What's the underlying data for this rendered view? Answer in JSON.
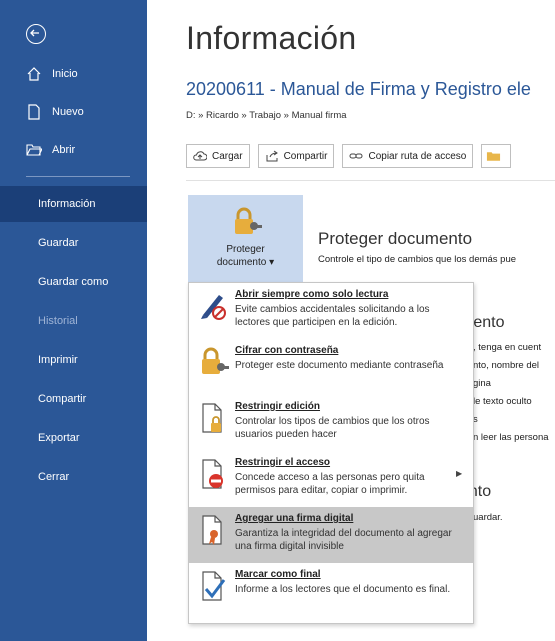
{
  "sidebar": {
    "items": [
      {
        "label": "Inicio"
      },
      {
        "label": "Nuevo"
      },
      {
        "label": "Abrir"
      },
      {
        "label": "Información"
      },
      {
        "label": "Guardar"
      },
      {
        "label": "Guardar como"
      },
      {
        "label": "Historial"
      },
      {
        "label": "Imprimir"
      },
      {
        "label": "Compartir"
      },
      {
        "label": "Exportar"
      },
      {
        "label": "Cerrar"
      }
    ]
  },
  "main": {
    "title": "Información",
    "doc_title": "20200611 - Manual de Firma y Registro ele",
    "doc_path": "D: » Ricardo » Trabajo » Manual firma",
    "actions": [
      {
        "label": "Cargar"
      },
      {
        "label": "Compartir"
      },
      {
        "label": "Copiar ruta de acceso"
      }
    ],
    "protect": {
      "button_line1": "Proteger",
      "button_line2": "documento",
      "section_title": "Proteger documento",
      "section_desc": "Controle el tipo de cambios que los demás pue"
    },
    "background_fragments": {
      "inspect_title": "mento",
      "inspect_l1": ", tenga en cuent",
      "inspect_l2": "nto, nombre del",
      "inspect_l3": "gina",
      "inspect_l4": "le texto oculto",
      "inspect_l5": "s",
      "inspect_l6": "n leer las persona",
      "versions_title": "ento",
      "versions_l1": "uardar."
    }
  },
  "menu": {
    "items": [
      {
        "title": "Abrir siempre como solo lectura",
        "desc": "Evite cambios accidentales solicitando a los lectores que participen en la edición."
      },
      {
        "title": "Cifrar con contraseña",
        "desc": "Proteger este documento mediante contraseña"
      },
      {
        "title": "Restringir edición",
        "desc": "Controlar los tipos de cambios que los otros usuarios pueden hacer"
      },
      {
        "title": "Restringir el acceso",
        "desc": "Concede acceso a las personas pero quita permisos para editar, copiar o imprimir."
      },
      {
        "title": "Agregar una firma digital",
        "desc": "Garantiza la integridad del documento al agregar una firma digital invisible"
      },
      {
        "title": "Marcar como final",
        "desc": "Informe a los lectores que el documento es final."
      }
    ]
  },
  "colors": {
    "sidebar": "#2b5797",
    "sidebar_active": "#1b3f78",
    "accent": "#2b5797",
    "tile": "#c8d8ee",
    "menu_hover": "#c8c8c8"
  },
  "icons": [
    "back-arrow-icon",
    "home-icon",
    "new-doc-icon",
    "open-folder-icon",
    "upload-icon",
    "share-icon",
    "link-icon",
    "folder-icon",
    "lock-key-icon",
    "pencil-icon",
    "restrict-icon",
    "no-entry-icon",
    "certificate-icon",
    "checkmark-doc-icon"
  ]
}
